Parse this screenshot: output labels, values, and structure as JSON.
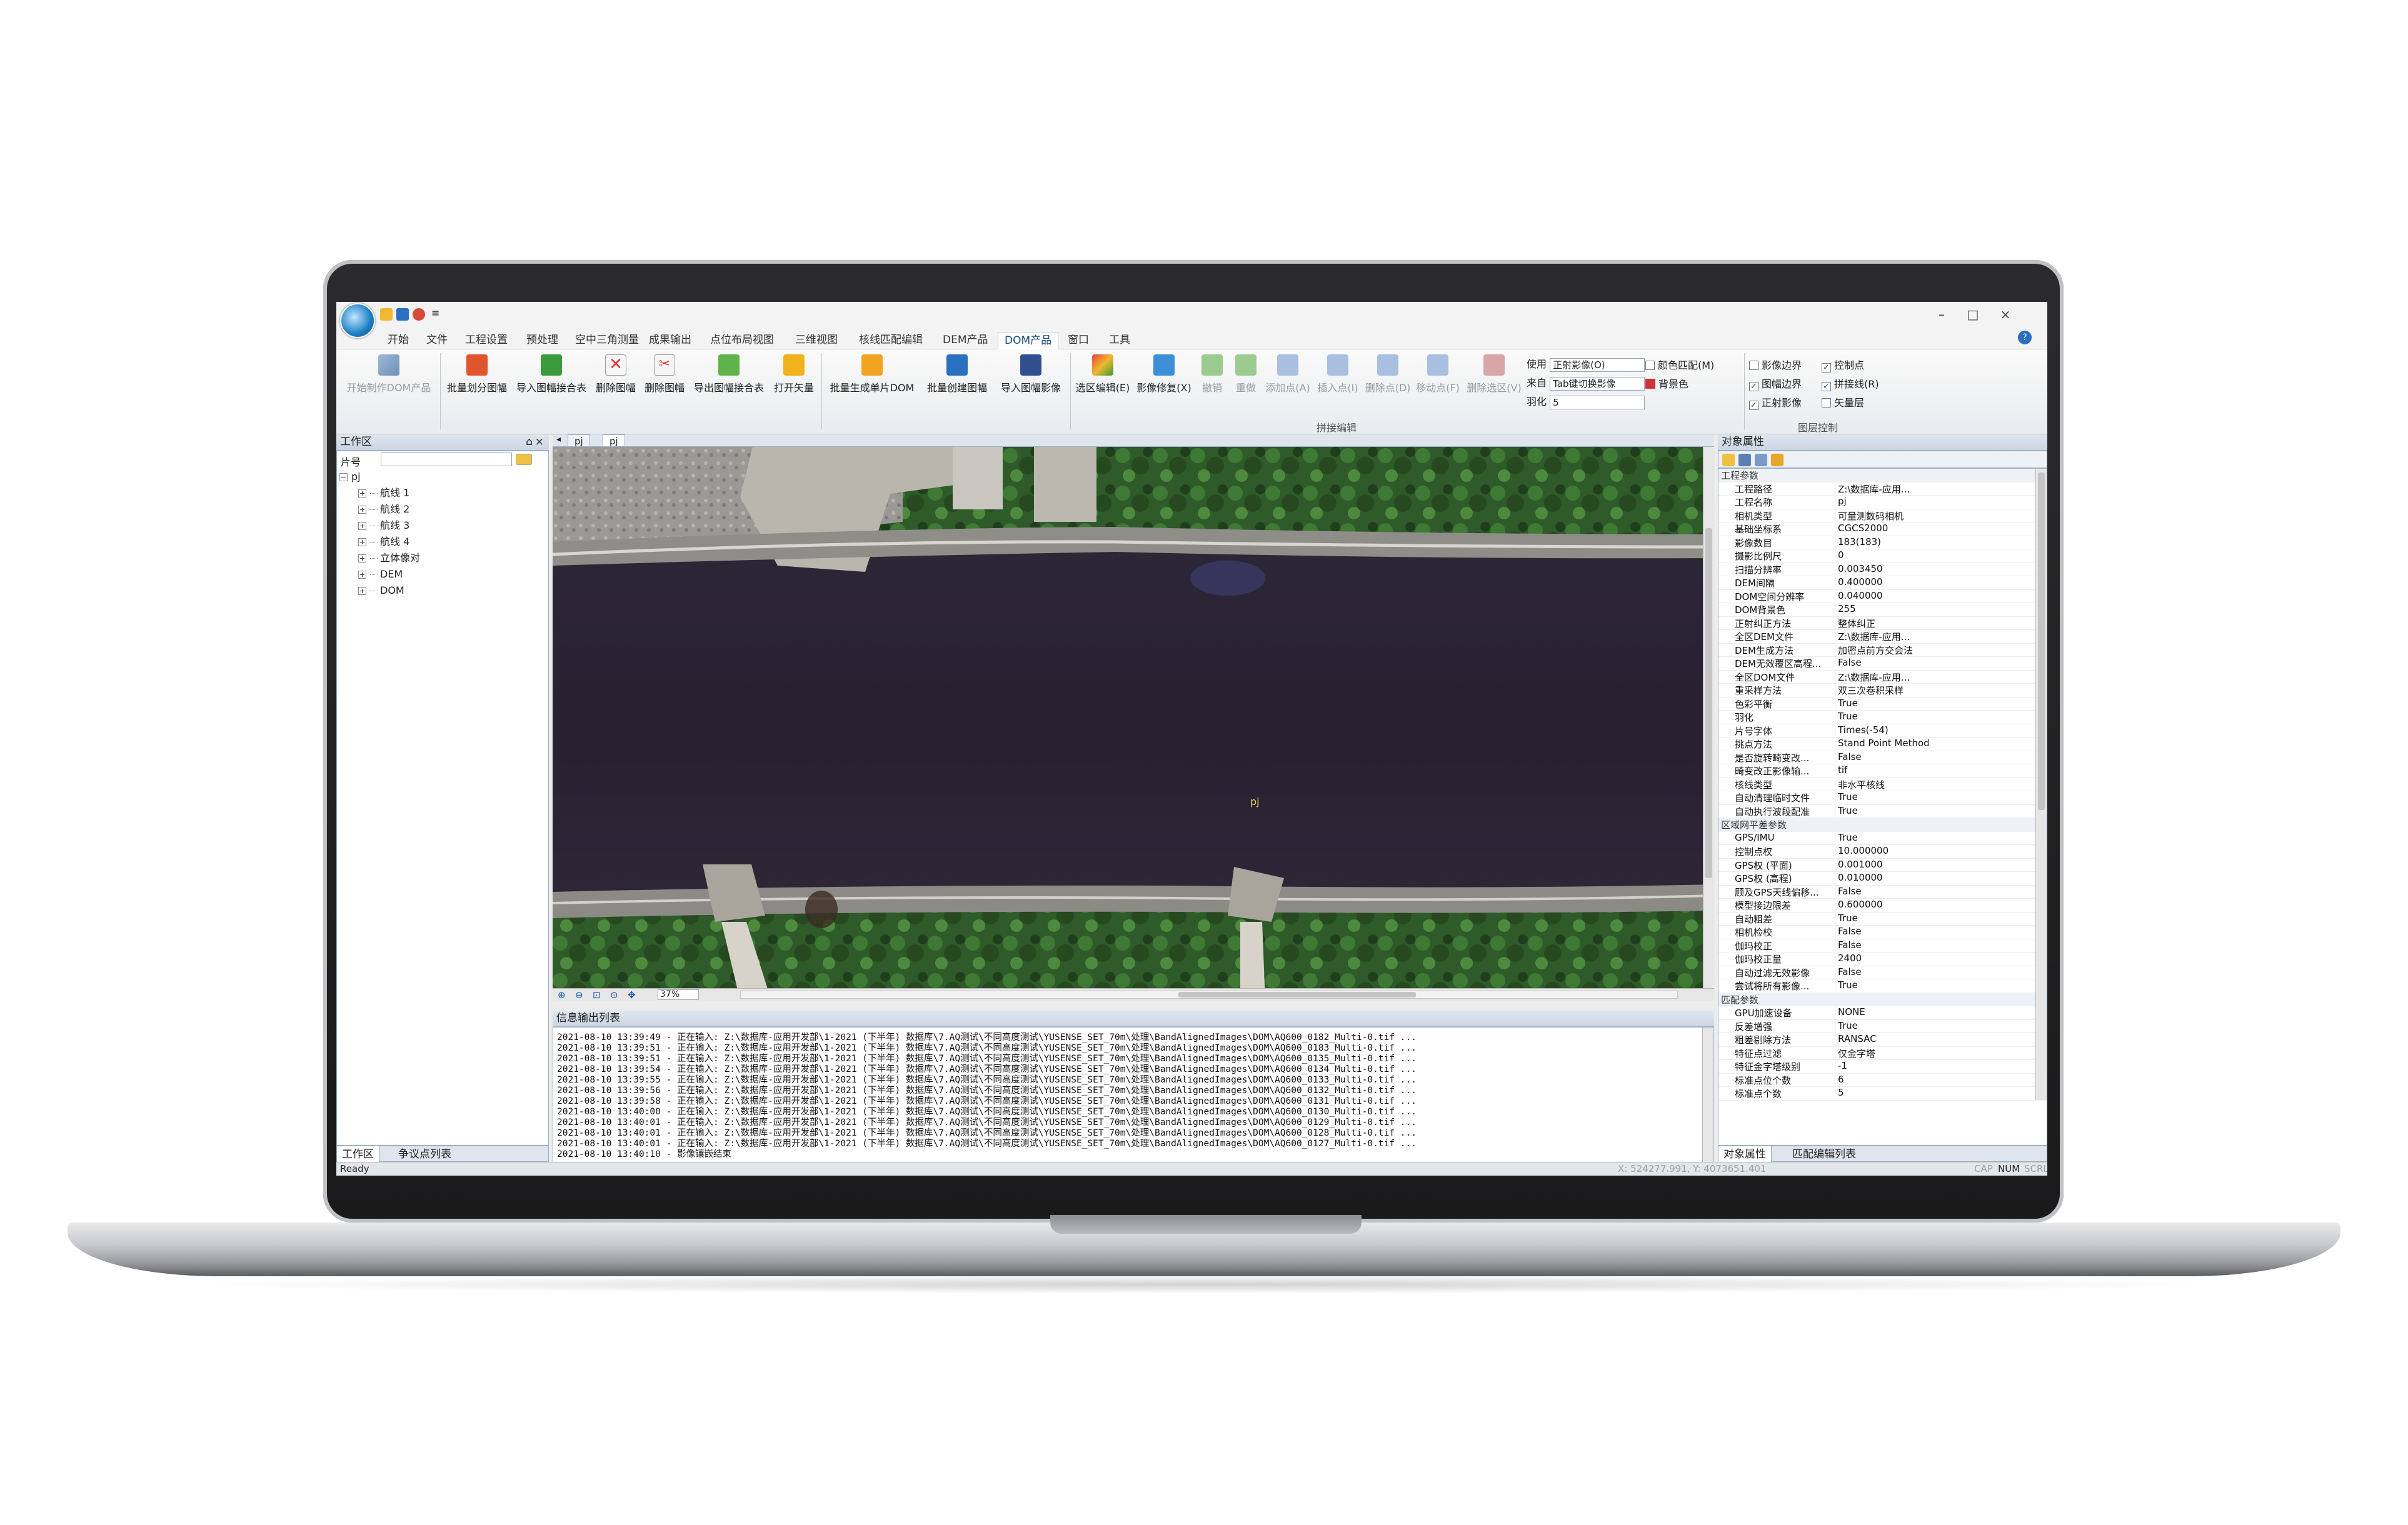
{
  "titlebar": {
    "title_glyph": "≡",
    "min": "–",
    "max": "□",
    "close": "×",
    "help": "?"
  },
  "menu": [
    "开始",
    "文件",
    "工程设置",
    "预处理",
    "空中三角测量",
    "成果输出",
    "点位布局视图",
    "三维视图",
    "核线匹配编辑",
    "DEM产品",
    "DOM产品",
    "窗口",
    "工具"
  ],
  "menu_active_index": 10,
  "ribbon": {
    "buttons": [
      "开始制作DOM产品",
      "批量划分图幅",
      "导入图幅接合表",
      "删除图幅",
      "删除图幅",
      "导出图幅接合表",
      "打开矢量",
      "批量生成单片DOM",
      "批量创建图幅",
      "导入图幅影像",
      "选区编辑(E)",
      "影像修复(X)",
      "撤销",
      "重做",
      "添加点(A)",
      "插入点(I)",
      "删除点(D)",
      "移动点(F)",
      "删除选区(V)"
    ],
    "use_label": "使用",
    "use_value": "正射影像(O)",
    "from_label": "来自",
    "from_value": "Tab键切换影像",
    "feather_label": "羽化",
    "feather_value": "5",
    "color_match": "颜色匹配(M)",
    "bg_color": "背景色",
    "group_mosaic": "拼接编辑",
    "layer_checks": [
      {
        "label": "影像边界",
        "checked": false
      },
      {
        "label": "控制点",
        "checked": true
      },
      {
        "label": "图幅边界",
        "checked": true
      },
      {
        "label": "拼接线(R)",
        "checked": true
      },
      {
        "label": "正射影像",
        "checked": true
      },
      {
        "label": "矢量层",
        "checked": false
      }
    ],
    "group_layer": "图层控制"
  },
  "workspace": {
    "title": "工作区",
    "pin": "⌂",
    "close": "×",
    "filter_label": "片号",
    "tree": [
      {
        "label": "pj",
        "level": 0,
        "exp": "−"
      },
      {
        "label": "航线 1",
        "level": 1,
        "exp": "+"
      },
      {
        "label": "航线 2",
        "level": 1,
        "exp": "+"
      },
      {
        "label": "航线 3",
        "level": 1,
        "exp": "+"
      },
      {
        "label": "航线 4",
        "level": 1,
        "exp": "+"
      },
      {
        "label": "立体像对",
        "level": 1,
        "exp": "+"
      },
      {
        "label": "DEM",
        "level": 1,
        "exp": "+"
      },
      {
        "label": "DOM",
        "level": 1,
        "exp": "+"
      }
    ],
    "tabs": [
      "工作区",
      "争议点列表"
    ]
  },
  "doc_tabs": [
    "pj",
    "pj"
  ],
  "view": {
    "label": "pj",
    "zoom": "37%"
  },
  "log": {
    "title": "信息输出列表",
    "lines": [
      "2021-08-10 13:39:49 - 正在输入: Z:\\数据库-应用开发部\\1-2021 (下半年) 数据库\\7.AQ测试\\不同高度测试\\YUSENSE_SET_70m\\处理\\BandAlignedImages\\DOM\\AQ600_0182_Multi-0.tif ...",
      "2021-08-10 13:39:51 - 正在输入: Z:\\数据库-应用开发部\\1-2021 (下半年) 数据库\\7.AQ测试\\不同高度测试\\YUSENSE_SET_70m\\处理\\BandAlignedImages\\DOM\\AQ600_0183_Multi-0.tif ...",
      "2021-08-10 13:39:51 - 正在输入: Z:\\数据库-应用开发部\\1-2021 (下半年) 数据库\\7.AQ测试\\不同高度测试\\YUSENSE_SET_70m\\处理\\BandAlignedImages\\DOM\\AQ600_0135_Multi-0.tif ...",
      "2021-08-10 13:39:54 - 正在输入: Z:\\数据库-应用开发部\\1-2021 (下半年) 数据库\\7.AQ测试\\不同高度测试\\YUSENSE_SET_70m\\处理\\BandAlignedImages\\DOM\\AQ600_0134_Multi-0.tif ...",
      "2021-08-10 13:39:55 - 正在输入: Z:\\数据库-应用开发部\\1-2021 (下半年) 数据库\\7.AQ测试\\不同高度测试\\YUSENSE_SET_70m\\处理\\BandAlignedImages\\DOM\\AQ600_0133_Multi-0.tif ...",
      "2021-08-10 13:39:56 - 正在输入: Z:\\数据库-应用开发部\\1-2021 (下半年) 数据库\\7.AQ测试\\不同高度测试\\YUSENSE_SET_70m\\处理\\BandAlignedImages\\DOM\\AQ600_0132_Multi-0.tif ...",
      "2021-08-10 13:39:58 - 正在输入: Z:\\数据库-应用开发部\\1-2021 (下半年) 数据库\\7.AQ测试\\不同高度测试\\YUSENSE_SET_70m\\处理\\BandAlignedImages\\DOM\\AQ600_0131_Multi-0.tif ...",
      "2021-08-10 13:40:00 - 正在输入: Z:\\数据库-应用开发部\\1-2021 (下半年) 数据库\\7.AQ测试\\不同高度测试\\YUSENSE_SET_70m\\处理\\BandAlignedImages\\DOM\\AQ600_0130_Multi-0.tif ...",
      "2021-08-10 13:40:01 - 正在输入: Z:\\数据库-应用开发部\\1-2021 (下半年) 数据库\\7.AQ测试\\不同高度测试\\YUSENSE_SET_70m\\处理\\BandAlignedImages\\DOM\\AQ600_0129_Multi-0.tif ...",
      "2021-08-10 13:40:01 - 正在输入: Z:\\数据库-应用开发部\\1-2021 (下半年) 数据库\\7.AQ测试\\不同高度测试\\YUSENSE_SET_70m\\处理\\BandAlignedImages\\DOM\\AQ600_0128_Multi-0.tif ...",
      "2021-08-10 13:40:01 - 正在输入: Z:\\数据库-应用开发部\\1-2021 (下半年) 数据库\\7.AQ测试\\不同高度测试\\YUSENSE_SET_70m\\处理\\BandAlignedImages\\DOM\\AQ600_0127_Multi-0.tif ...",
      "2021-08-10 13:40:10 - 影像镶嵌结束"
    ]
  },
  "props": {
    "title": "对象属性",
    "rows": [
      {
        "sec": "工程参数"
      },
      {
        "k": "工程路径",
        "v": "Z:\\数据库-应用..."
      },
      {
        "k": "工程名称",
        "v": "pj"
      },
      {
        "k": "相机类型",
        "v": "可量测数码相机"
      },
      {
        "k": "基础坐标系",
        "v": "CGCS2000"
      },
      {
        "k": "影像数目",
        "v": "183(183)"
      },
      {
        "k": "摄影比例尺",
        "v": "0"
      },
      {
        "k": "扫描分辨率",
        "v": "0.003450"
      },
      {
        "k": "DEM间隔",
        "v": "0.400000"
      },
      {
        "k": "DOM空间分辨率",
        "v": "0.040000"
      },
      {
        "k": "DOM背景色",
        "v": "255"
      },
      {
        "k": "正射纠正方法",
        "v": "整体纠正"
      },
      {
        "k": "全区DEM文件",
        "v": "Z:\\数据库-应用..."
      },
      {
        "k": "DEM生成方法",
        "v": "加密点前方交会法"
      },
      {
        "k": "DEM无效覆区高程...",
        "v": "False"
      },
      {
        "k": "全区DOM文件",
        "v": "Z:\\数据库-应用..."
      },
      {
        "k": "重采样方法",
        "v": "双三次卷积采样"
      },
      {
        "k": "色彩平衡",
        "v": "True"
      },
      {
        "k": "羽化",
        "v": "True"
      },
      {
        "k": "片号字体",
        "v": "Times(-54)"
      },
      {
        "k": "挑点方法",
        "v": "Stand Point Method"
      },
      {
        "k": "是否旋转畸变改...",
        "v": "False"
      },
      {
        "k": "畸变改正影像输...",
        "v": "tif"
      },
      {
        "k": "核线类型",
        "v": "非水平核线"
      },
      {
        "k": "自动清理临时文件",
        "v": "True"
      },
      {
        "k": "自动执行波段配准",
        "v": "True"
      },
      {
        "sec": "区域网平差参数"
      },
      {
        "k": "GPS/IMU",
        "v": "True"
      },
      {
        "k": "控制点权",
        "v": "10.000000"
      },
      {
        "k": "GPS权 (平面)",
        "v": "0.001000"
      },
      {
        "k": "GPS权 (高程)",
        "v": "0.010000"
      },
      {
        "k": "顾及GPS天线偏移...",
        "v": "False"
      },
      {
        "k": "模型接边限差",
        "v": "0.600000"
      },
      {
        "k": "自动粗差",
        "v": "True"
      },
      {
        "k": "相机检校",
        "v": "False"
      },
      {
        "k": "伽玛校正",
        "v": "False"
      },
      {
        "k": "伽玛校正量",
        "v": "2400"
      },
      {
        "k": "自动过滤无效影像",
        "v": "False"
      },
      {
        "k": "尝试将所有影像...",
        "v": "True"
      },
      {
        "sec": "匹配参数"
      },
      {
        "k": "GPU加速设备",
        "v": "NONE"
      },
      {
        "k": "反差增强",
        "v": "True"
      },
      {
        "k": "粗差剔除方法",
        "v": "RANSAC"
      },
      {
        "k": "特征点过滤",
        "v": "仅金字塔"
      },
      {
        "k": "特征金字塔级别",
        "v": "-1"
      },
      {
        "k": "标准点位个数",
        "v": "6"
      },
      {
        "k": "标准点个数",
        "v": "5"
      }
    ],
    "tabs": [
      "对象属性",
      "匹配编辑列表"
    ]
  },
  "status": {
    "ready": "Ready",
    "coord": "X: 524277.991, Y: 4073651.401",
    "cap": "CAP",
    "num": "NUM",
    "scrl": "SCRL"
  }
}
